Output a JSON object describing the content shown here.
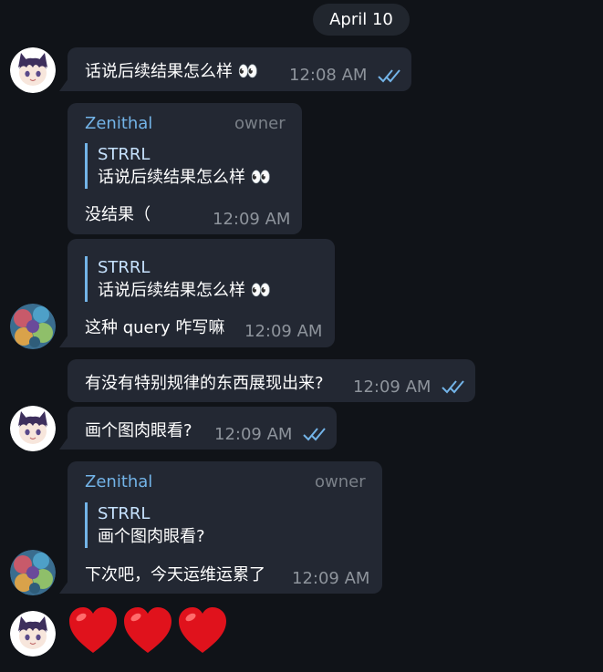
{
  "date_label": "April 10",
  "colors": {
    "background": "#101318",
    "bubble": "#232833",
    "accent": "#73b4e8",
    "heart": "#e0121c"
  },
  "messages": [
    {
      "text": "话说后续结果怎么样",
      "emoji": "👀",
      "time": "12:08 AM",
      "read_icon": "double-check-icon"
    },
    {
      "sender": "Zenithal",
      "role": "owner",
      "reply": {
        "name": "STRRL",
        "text": "话说后续结果怎么样",
        "emoji": "👀"
      },
      "text": "没结果（",
      "time": "12:09 AM"
    },
    {
      "reply": {
        "name": "STRRL",
        "text": "话说后续结果怎么样",
        "emoji": "👀"
      },
      "text": "这种 query 咋写嘛",
      "time": "12:09 AM"
    },
    {
      "text": "有没有特别规律的东西展现出来?",
      "time": "12:09 AM",
      "read_icon": "double-check-icon"
    },
    {
      "text": "画个图肉眼看?",
      "time": "12:09 AM",
      "read_icon": "double-check-icon"
    },
    {
      "sender": "Zenithal",
      "role": "owner",
      "reply": {
        "name": "STRRL",
        "text": "画个图肉眼看?"
      },
      "text": "下次吧，今天运维运累了",
      "time": "12:09 AM"
    }
  ],
  "final_emojis": [
    "heart-emoji",
    "heart-emoji",
    "heart-emoji"
  ]
}
